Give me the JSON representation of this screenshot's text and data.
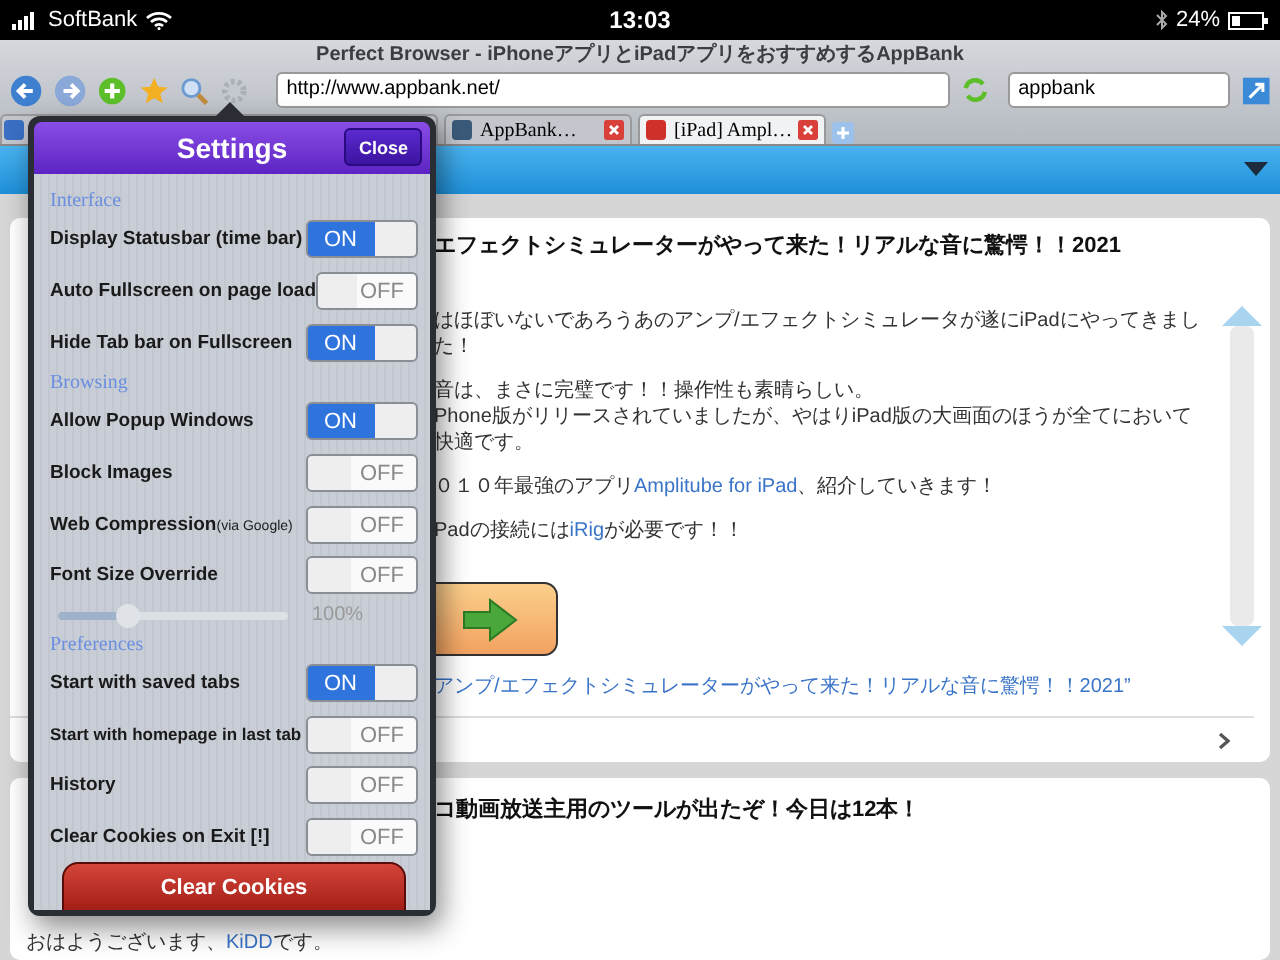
{
  "status_bar": {
    "carrier": "SoftBank",
    "time": "13:03",
    "battery": "24%"
  },
  "browser": {
    "title": "Perfect Browser - iPhoneアプリとiPadアプリをおすすめするAppBank",
    "url": "http://www.appbank.net/",
    "search": "appbank"
  },
  "tabs": [
    {
      "selected": false,
      "color": "#3a6fc4"
    },
    {
      "title": "AppBank…",
      "selected": false,
      "color": "#3b5a7a"
    },
    {
      "title": "[iPad] Ampl…",
      "selected": true,
      "color": "#d0302a"
    }
  ],
  "settings": {
    "title": "Settings",
    "close": "Close",
    "sections": [
      {
        "title": "Interface",
        "items": [
          {
            "kind": "toggle",
            "label": "Display Statusbar (time bar)",
            "on": true,
            "switch_text": "ON"
          },
          {
            "kind": "toggle",
            "label": "Auto Fullscreen on page load",
            "on": false,
            "switch_text": "OFF"
          },
          {
            "kind": "toggle",
            "label": "Hide Tab bar on Fullscreen",
            "on": true,
            "switch_text": "ON"
          }
        ]
      },
      {
        "title": "Browsing",
        "items": [
          {
            "kind": "toggle",
            "label": "Allow Popup Windows",
            "on": true,
            "switch_text": "ON"
          },
          {
            "kind": "toggle",
            "label": "Block Images",
            "on": false,
            "switch_text": "OFF"
          },
          {
            "kind": "toggle",
            "label": "Web Compression",
            "note": "(via Google)",
            "on": false,
            "switch_text": "OFF"
          },
          {
            "kind": "toggle",
            "label": "Font Size Override",
            "on": false,
            "switch_text": "OFF"
          },
          {
            "kind": "slider",
            "level": 0.3,
            "reading": "100%"
          }
        ]
      },
      {
        "title": "Preferences",
        "items": [
          {
            "kind": "toggle",
            "label": "Start with saved tabs",
            "on": true,
            "switch_text": "ON"
          },
          {
            "kind": "toggle",
            "label": "Start with homepage in last tab",
            "small": true,
            "on": false,
            "switch_text": "OFF"
          },
          {
            "kind": "toggle",
            "label": "History",
            "on": false,
            "switch_text": "OFF"
          },
          {
            "kind": "toggle",
            "label": "Clear Cookies on Exit [!]",
            "on": false,
            "switch_text": "OFF"
          }
        ]
      }
    ],
    "button": "Clear Cookies"
  },
  "articles": [
    {
      "title": "エフェクトシミュレーターがやって来た！リアルな音に驚愕！！2021",
      "blocks": [
        {
          "kind": "paragraph",
          "lines": [
            [
              {
                "text": "はほぼいないであろうあのアンプ/エフェクトシミュレータが遂にiPadにやってきました！"
              }
            ]
          ]
        },
        {
          "kind": "paragraph",
          "lines": [
            [
              {
                "text": "音は、まさに完璧です！！操作性も素晴らしい。"
              }
            ],
            [
              {
                "text": "Phone版がリリースされていましたが、やはりiPad版の大画面のほうが全てにおいて快適です。"
              }
            ]
          ]
        },
        {
          "kind": "paragraph",
          "lines": [
            [
              {
                "text": "０１０年最強のアプリ"
              },
              {
                "text": "Amplitube for iPad",
                "link": true
              },
              {
                "text": "、紹介していきます！"
              }
            ]
          ]
        },
        {
          "kind": "paragraph",
          "lines": [
            [
              {
                "text": "Padの接続には"
              },
              {
                "text": "iRig",
                "link": true
              },
              {
                "text": "が必要です！！"
              }
            ]
          ]
        },
        {
          "kind": "banner"
        },
        {
          "kind": "source",
          "text": "アンプ/エフェクトシミュレーターがやって来た！リアルな音に驚愕！！2021”"
        },
        {
          "kind": "more"
        }
      ]
    },
    {
      "title": "コ動画放送主用のツールが出たぞ！今日は12本！",
      "blocks": [
        {
          "kind": "greeting",
          "parts": [
            {
              "text": "おはようございます、"
            },
            {
              "text": "KiDD",
              "link": true
            },
            {
              "text": "です。"
            }
          ]
        }
      ]
    }
  ]
}
